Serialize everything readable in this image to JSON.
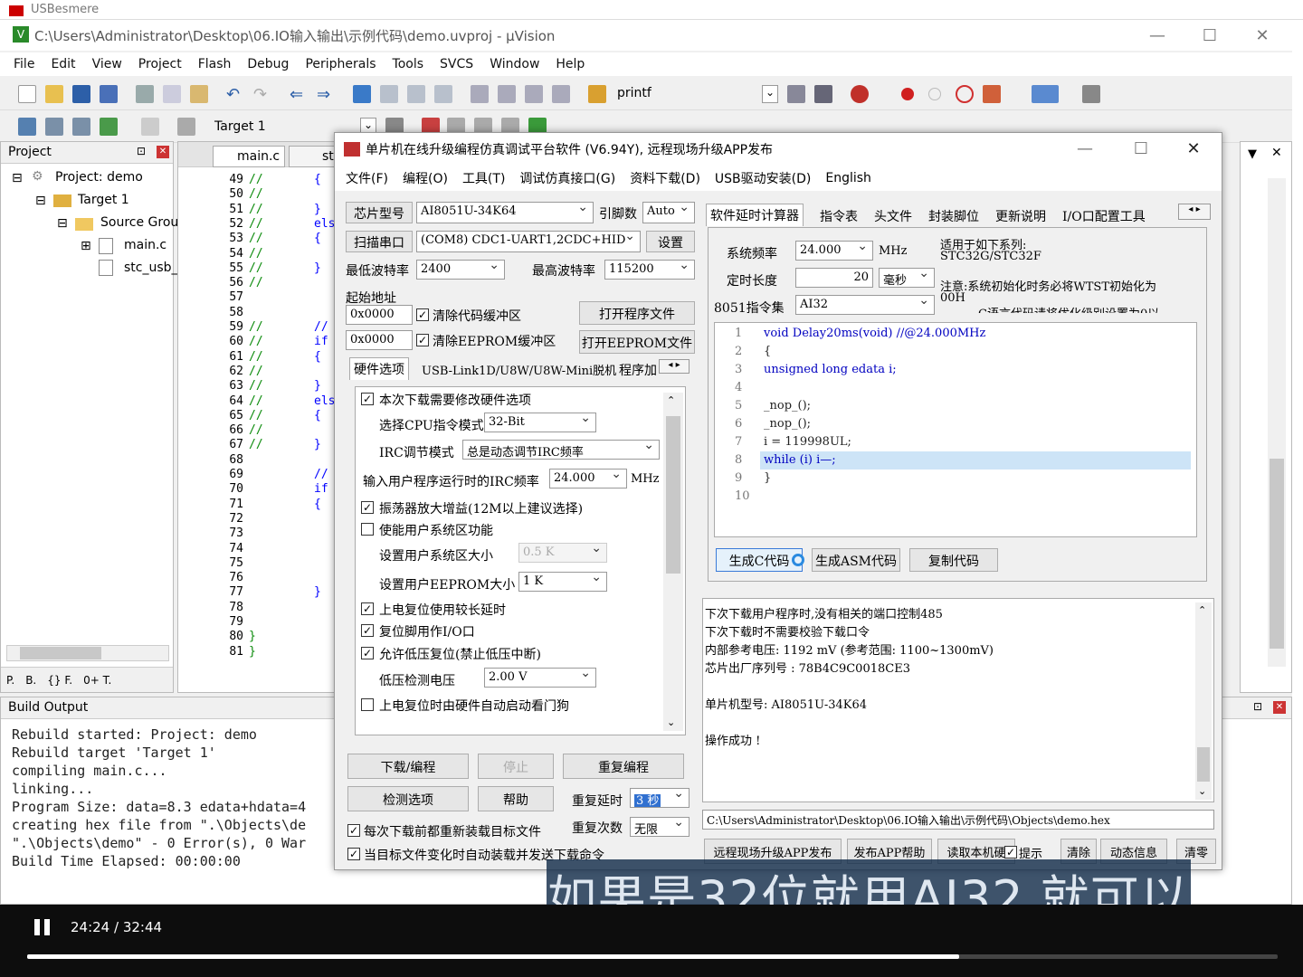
{
  "uv": {
    "top_strip": "USBesmere",
    "title": "C:\\Users\\Administrator\\Desktop\\06.IO输入输出\\示例代码\\demo.uvproj - µVision",
    "menu": [
      "File",
      "Edit",
      "View",
      "Project",
      "Flash",
      "Debug",
      "Peripherals",
      "Tools",
      "SVCS",
      "Window",
      "Help"
    ],
    "toolbar_find": "printf",
    "target_select": "Target 1",
    "project_pane": {
      "title": "Project",
      "root": "Project: demo",
      "target": "Target 1",
      "group": "Source Grou",
      "files": [
        "main.c",
        "stc_usb_"
      ],
      "bottom_tabs": [
        "P.",
        "B.",
        "{} F.",
        "0+ T."
      ]
    },
    "editor": {
      "tabs": [
        "main.c",
        "st"
      ],
      "line_start": 49,
      "lines": [
        {
          "n": "49",
          "c": "//",
          "k": "{"
        },
        {
          "n": "50",
          "c": "//",
          "k": ""
        },
        {
          "n": "51",
          "c": "//",
          "k": "}"
        },
        {
          "n": "52",
          "c": "//",
          "k": "els"
        },
        {
          "n": "53",
          "c": "//",
          "k": "{"
        },
        {
          "n": "54",
          "c": "//",
          "k": ""
        },
        {
          "n": "55",
          "c": "//",
          "k": "}"
        },
        {
          "n": "56",
          "c": "//",
          "k": ""
        },
        {
          "n": "57",
          "c": "",
          "k": ""
        },
        {
          "n": "58",
          "c": "",
          "k": ""
        },
        {
          "n": "59",
          "c": "//",
          "k": "//"
        },
        {
          "n": "60",
          "c": "//",
          "k": "if"
        },
        {
          "n": "61",
          "c": "//",
          "k": "{"
        },
        {
          "n": "62",
          "c": "//",
          "k": ""
        },
        {
          "n": "63",
          "c": "//",
          "k": "}"
        },
        {
          "n": "64",
          "c": "//",
          "k": "els"
        },
        {
          "n": "65",
          "c": "//",
          "k": "{"
        },
        {
          "n": "66",
          "c": "//",
          "k": ""
        },
        {
          "n": "67",
          "c": "//",
          "k": "}"
        },
        {
          "n": "68",
          "c": "",
          "k": ""
        },
        {
          "n": "69",
          "c": "",
          "k": "//"
        },
        {
          "n": "70",
          "c": "",
          "k": "if"
        },
        {
          "n": "71",
          "c": "",
          "k": "{"
        },
        {
          "n": "72",
          "c": "",
          "k": ""
        },
        {
          "n": "73",
          "c": "",
          "k": ""
        },
        {
          "n": "74",
          "c": "",
          "k": ""
        },
        {
          "n": "75",
          "c": "",
          "k": ""
        },
        {
          "n": "76",
          "c": "",
          "k": ""
        },
        {
          "n": "77",
          "c": "",
          "k": "}"
        },
        {
          "n": "78",
          "c": "",
          "k": ""
        },
        {
          "n": "79",
          "c": "",
          "k": ""
        },
        {
          "n": "80",
          "c": "}",
          "k": ""
        },
        {
          "n": "81",
          "c": "}",
          "k": ""
        }
      ]
    },
    "build_output": {
      "title": "Build Output",
      "lines": [
        "Rebuild started: Project: demo",
        "Rebuild target 'Target 1'",
        "compiling main.c...",
        "linking...",
        "Program Size: data=8.3 edata+hdata=4",
        "creating hex file from \".\\Objects\\de",
        "\".\\Objects\\demo\" - 0 Error(s), 0 War",
        "Build Time Elapsed:  00:00:00"
      ]
    }
  },
  "stc": {
    "title": "单片机在线升级编程仿真调试平台软件 (V6.94Y), 远程现场升级APP发布",
    "menu": [
      "文件(F)",
      "编程(O)",
      "工具(T)",
      "调试仿真接口(G)",
      "资料下载(D)",
      "USB驱动安装(D)",
      "English"
    ],
    "chip_label": "芯片型号",
    "chip_value": "AI8051U-34K64",
    "pins_label": "引脚数",
    "pins_value": "Auto",
    "scan_button": "扫描串口",
    "port_value": "(COM8) CDC1-UART1,2CDC+HID",
    "settings_button": "设置",
    "min_baud_label": "最低波特率",
    "min_baud_value": "2400",
    "max_baud_label": "最高波特率",
    "max_baud_value": "115200",
    "start_addr_label": "起始地址",
    "addr1": "0x0000",
    "clear_code_label": "清除代码缓冲区",
    "open_prog_button": "打开程序文件",
    "addr2": "0x0000",
    "clear_eeprom_label": "清除EEPROM缓冲区",
    "open_eeprom_button": "打开EEPROM文件",
    "left_tabs": [
      "硬件选项",
      "USB-Link1D/U8W/U8W-Mini脱机",
      "程序加"
    ],
    "hw": {
      "modify_hw": "本次下载需要修改硬件选项",
      "cpu_mode_label": "选择CPU指令模式",
      "cpu_mode_value": "32-Bit",
      "irc_mode_label": "IRC调节模式",
      "irc_mode_value": "总是动态调节IRC频率",
      "irc_freq_label": "输入用户程序运行时的IRC频率",
      "irc_freq_value": "24.000",
      "irc_freq_unit": "MHz",
      "osc_gain": "振荡器放大增益(12M以上建议选择)",
      "user_sys": "使能用户系统区功能",
      "sys_size_label": "设置用户系统区大小",
      "sys_size_value": "0.5 K",
      "eeprom_size_label": "设置用户EEPROM大小",
      "eeprom_size_value": "1    K",
      "long_reset": "上电复位使用较长延时",
      "reset_io": "复位脚用作I/O口",
      "lvd_reset": "允许低压复位(禁止低压中断)",
      "lvd_voltage_label": "低压检测电压",
      "lvd_voltage_value": "2.00 V",
      "wdt": "上电复位时由硬件自动启动看门狗"
    },
    "download_button": "下载/编程",
    "stop_button": "停止",
    "reprogram_button": "重复编程",
    "check_button": "检测选项",
    "help_button": "帮助",
    "repeat_delay_label": "重复延时",
    "repeat_delay_value": "3 秒",
    "repeat_count_label": "重复次数",
    "repeat_count_value": "无限",
    "reload_each": "每次下载前都重新装载目标文件",
    "auto_reload": "当目标文件变化时自动装载并发送下载命令",
    "right_tabs": [
      "软件延时计算器",
      "指令表",
      "头文件",
      "封装脚位",
      "更新说明",
      "I/O口配置工具"
    ],
    "sys_freq_label": "系统频率",
    "sys_freq_value": "24.000",
    "sys_freq_unit": "MHz",
    "delay_len_label": "定时长度",
    "delay_len_value": "20",
    "delay_unit": "毫秒",
    "isa_label": "8051指令集",
    "isa_value": "AI32",
    "note_series": "适用于如下系列:",
    "note_series2": "STC32G/STC32F",
    "note_caution": "注意:系统初始化时务必将WTST初始化为",
    "note_caution2": "00H",
    "note_caution3": "C语言代码请将优化级别设置为0以",
    "code_lines": [
      {
        "n": "1",
        "t": "void Delay20ms(void)        //@24.000MHz"
      },
      {
        "n": "2",
        "t": "{"
      },
      {
        "n": "3",
        "t": "    unsigned long edata i;"
      },
      {
        "n": "4",
        "t": ""
      },
      {
        "n": "5",
        "t": "    _nop_();"
      },
      {
        "n": "6",
        "t": "    _nop_();"
      },
      {
        "n": "7",
        "t": "    i = 119998UL;"
      },
      {
        "n": "8",
        "t": "    while (i) i—;"
      },
      {
        "n": "9",
        "t": "}"
      },
      {
        "n": "10",
        "t": ""
      }
    ],
    "gen_c_button": "生成C代码",
    "gen_asm_button": "生成ASM代码",
    "copy_button": "复制代码",
    "output_lines": [
      "  下次下载用户程序时,没有相关的端口控制485",
      "  下次下载时不需要校验下载口令",
      "  内部参考电压: 1192 mV (参考范围: 1100~1300mV)",
      "芯片出厂序列号 : 78B4C9C0018CE3",
      "",
      "  单片机型号: AI8051U-34K64",
      "",
      "操作成功 !"
    ],
    "hex_path": "C:\\Users\\Administrator\\Desktop\\06.IO输入输出\\示例代码\\Objects\\demo.hex",
    "bottom_buttons": [
      "远程现场升级APP发布",
      "发布APP帮助",
      "读取本机硬",
      "提示",
      "清除",
      "动态信息",
      "清零"
    ]
  },
  "video": {
    "subtitle": "如果是32位就用AI32 就可以",
    "time": "24:24 / 32:44",
    "progress": 0.745
  }
}
